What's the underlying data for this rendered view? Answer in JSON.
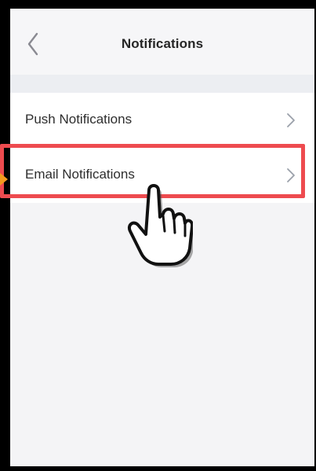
{
  "header": {
    "title": "Notifications",
    "back_icon": "chevron-left-icon"
  },
  "settings": {
    "items": [
      {
        "label": "Push Notifications",
        "icon": "chevron-right-icon"
      },
      {
        "label": "Email Notifications",
        "icon": "chevron-right-icon"
      }
    ]
  },
  "annotation": {
    "highlight_color": "#ee4b4f",
    "arrow_color": "#f39a1d",
    "cursor_icon": "pointing-hand-icon"
  }
}
